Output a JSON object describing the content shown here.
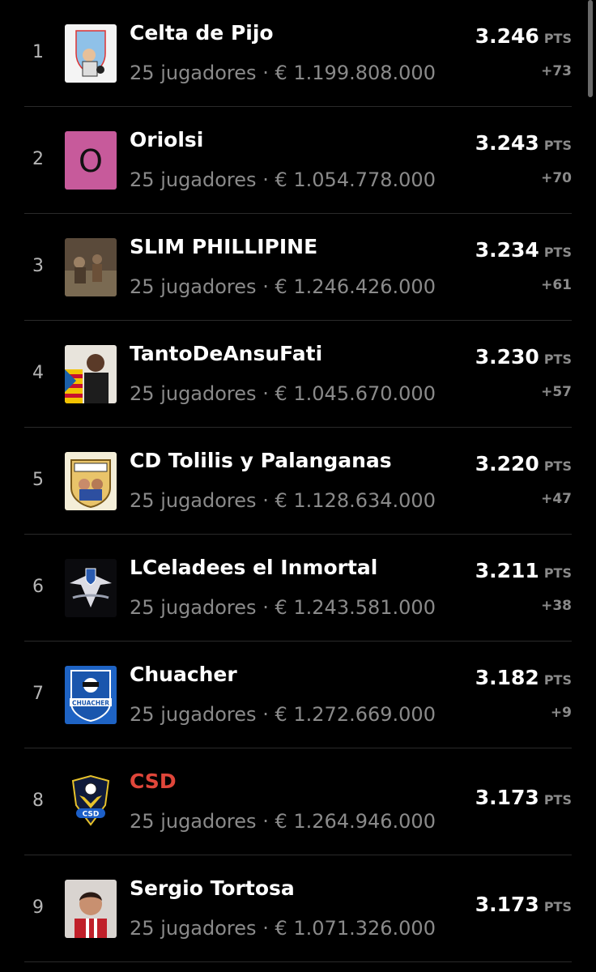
{
  "points_unit": "PTS",
  "players_suffix": "jugadores",
  "separator": "·",
  "currency": "€",
  "colors": {
    "background": "#000000",
    "primary_text": "#ffffff",
    "secondary_text": "#8a8a8a",
    "highlight_name": "#e0463a"
  },
  "teams": [
    {
      "rank": "1",
      "name": "Celta de Pijo",
      "players": "25",
      "value": "1.199.808.000",
      "points": "3.246",
      "delta": "+73",
      "avatar_icon": "celta-crest-icon",
      "highlight": false
    },
    {
      "rank": "2",
      "name": "Oriolsi",
      "players": "25",
      "value": "1.054.778.000",
      "points": "3.243",
      "delta": "+70",
      "avatar_icon": "letter-avatar",
      "avatar_letter": "O",
      "highlight": false
    },
    {
      "rank": "3",
      "name": "SLIM PHILLIPINE",
      "players": "25",
      "value": "1.246.426.000",
      "points": "3.234",
      "delta": "+61",
      "avatar_icon": "photo-avatar",
      "highlight": false
    },
    {
      "rank": "4",
      "name": "TantoDeAnsuFati",
      "players": "25",
      "value": "1.045.670.000",
      "points": "3.230",
      "delta": "+57",
      "avatar_icon": "photo-avatar",
      "highlight": false
    },
    {
      "rank": "5",
      "name": "CD Tolilis y Palanganas",
      "players": "25",
      "value": "1.128.634.000",
      "points": "3.220",
      "delta": "+47",
      "avatar_icon": "club-crest-icon",
      "highlight": false
    },
    {
      "rank": "6",
      "name": "LCeladees el Inmortal",
      "players": "25",
      "value": "1.243.581.000",
      "points": "3.211",
      "delta": "+38",
      "avatar_icon": "eagle-crest-icon",
      "highlight": false
    },
    {
      "rank": "7",
      "name": "Chuacher",
      "players": "25",
      "value": "1.272.669.000",
      "points": "3.182",
      "delta": "+9",
      "avatar_icon": "shield-crest-icon",
      "avatar_text": "CHUACHER",
      "highlight": false
    },
    {
      "rank": "8",
      "name": "CSD",
      "players": "25",
      "value": "1.264.946.000",
      "points": "3.173",
      "delta": "",
      "avatar_icon": "dragon-crest-icon",
      "avatar_text": "CSD",
      "highlight": true
    },
    {
      "rank": "9",
      "name": "Sergio Tortosa",
      "players": "25",
      "value": "1.071.326.000",
      "points": "3.173",
      "delta": "",
      "avatar_icon": "photo-avatar",
      "highlight": false
    }
  ]
}
